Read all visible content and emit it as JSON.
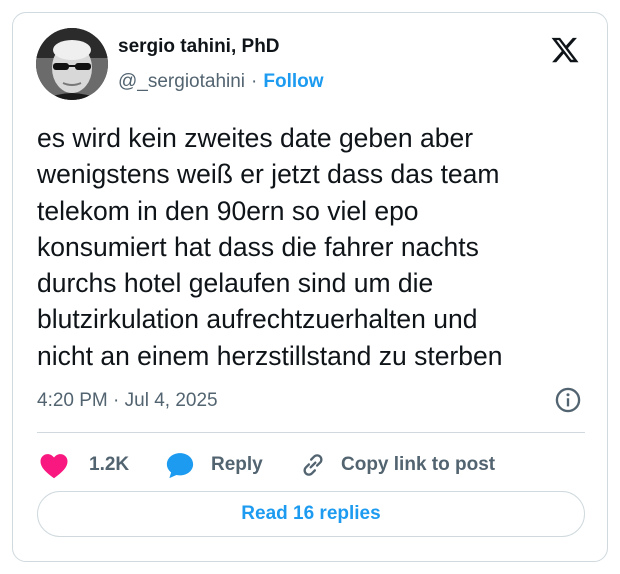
{
  "author": {
    "name": "sergio tahini, PhD",
    "handle": "@_sergiotahini",
    "separator": "·",
    "follow_label": "Follow",
    "avatar_icon": "avatar-portrait-with-sunglasses"
  },
  "platform_icon": "x-logo-icon",
  "tweet": {
    "lines": [
      "es wird kein zweites date geben aber",
      "wenigstens weiß er jetzt dass das team",
      "telekom in den 90ern so viel epo",
      "konsumiert hat dass die fahrer nachts",
      "durchs hotel gelaufen sind um die",
      "blutzirkulation aufrechtzuerhalten und",
      "nicht an einem herzstillstand zu sterben"
    ],
    "timestamp": "4:20 PM · Jul 4, 2025"
  },
  "actions": {
    "like_count": "1.2K",
    "reply_label": "Reply",
    "copy_label": "Copy link to post"
  },
  "read_replies_label": "Read 16 replies",
  "colors": {
    "accent": "#1d9bf0",
    "like": "#f91880",
    "text": "#0f1419",
    "secondary": "#536471",
    "border": "#cfd9de"
  }
}
